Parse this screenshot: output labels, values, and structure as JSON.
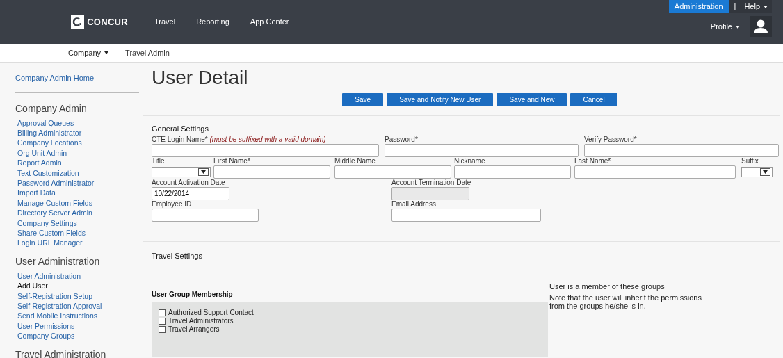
{
  "topnav": {
    "logo": "CONCUR",
    "links": [
      {
        "label": "Travel"
      },
      {
        "label": "Reporting"
      },
      {
        "label": "App Center"
      }
    ],
    "admin": {
      "label": "Administration",
      "selected": true
    },
    "separator": "|",
    "help": "Help",
    "profile": "Profile"
  },
  "subnav": [
    {
      "label": "Company",
      "dropdown": true,
      "selected": true
    },
    {
      "label": "Travel Admin",
      "dropdown": false,
      "selected": false
    }
  ],
  "sidebar": {
    "home": "Company Admin Home",
    "groups": [
      {
        "heading": "Company Admin",
        "items": [
          {
            "label": "Approval Queues",
            "selected": false
          },
          {
            "label": "Billing Administrator",
            "selected": false
          },
          {
            "label": "Company Locations",
            "selected": false
          },
          {
            "label": "Org Unit Admin",
            "selected": false
          },
          {
            "label": "Report Admin",
            "selected": false
          },
          {
            "label": "Text Customization",
            "selected": false
          },
          {
            "label": "Password Administrator",
            "selected": false
          },
          {
            "label": "Import Data",
            "selected": false
          },
          {
            "label": "Manage Custom Fields",
            "selected": false
          },
          {
            "label": "Directory Server Admin",
            "selected": false
          },
          {
            "label": "Company Settings",
            "selected": false
          },
          {
            "label": "Share Custom Fields",
            "selected": false
          },
          {
            "label": "Login URL Manager",
            "selected": false
          }
        ]
      },
      {
        "heading": "User Administration",
        "items": [
          {
            "label": "User Administration",
            "selected": false
          },
          {
            "label": "Add User",
            "selected": true
          },
          {
            "label": "Self-Registration Setup",
            "selected": false
          },
          {
            "label": "Self-Registration Approval",
            "selected": false
          },
          {
            "label": "Send Mobile Instructions",
            "selected": false
          },
          {
            "label": "User Permissions",
            "selected": false
          },
          {
            "label": "Company Groups",
            "selected": false
          }
        ]
      },
      {
        "heading": "Travel Administration"
      }
    ]
  },
  "page": {
    "title": "User Detail",
    "buttons": [
      "Save",
      "Save and Notify New User",
      "Save and New",
      "Cancel"
    ]
  },
  "general": {
    "heading": "General Settings",
    "fields": [
      {
        "label": "CTE Login Name*",
        "note": "(must be suffixed with a valid domain)",
        "kind": "text",
        "disabled": false
      },
      {
        "label": "Password*",
        "kind": "text",
        "disabled": false
      },
      {
        "label": "Verify Password*",
        "kind": "text",
        "disabled": false
      },
      {
        "label": "Title",
        "kind": "select",
        "disabled": false
      },
      {
        "label": "First Name*",
        "kind": "text",
        "disabled": false
      },
      {
        "label": "Middle Name",
        "kind": "text",
        "disabled": false
      },
      {
        "label": "Nickname",
        "kind": "text",
        "disabled": false
      },
      {
        "label": "Last Name*",
        "kind": "text",
        "disabled": false
      },
      {
        "label": "Suffix",
        "kind": "select",
        "disabled": false
      },
      {
        "label": "Account Activation Date",
        "kind": "text",
        "value": "10/22/2014",
        "disabled": false
      },
      {
        "label": "Account Termination Date",
        "kind": "text",
        "disabled": true
      },
      {
        "label": "Employee ID",
        "kind": "text",
        "disabled": false
      },
      {
        "label": "Email Address",
        "kind": "text",
        "disabled": false
      }
    ]
  },
  "travel": {
    "heading": "Travel Settings"
  },
  "groups": {
    "heading": "User Group Membership",
    "options": [
      {
        "label": "Authorized Support Contact",
        "checked": false
      },
      {
        "label": "Travel Administrators",
        "checked": false
      },
      {
        "label": "Travel Arrangers",
        "checked": false
      }
    ],
    "info_title": "User is a member of these groups",
    "info_note": "Note that the user will inherit the permissions from the groups he/she is in."
  }
}
